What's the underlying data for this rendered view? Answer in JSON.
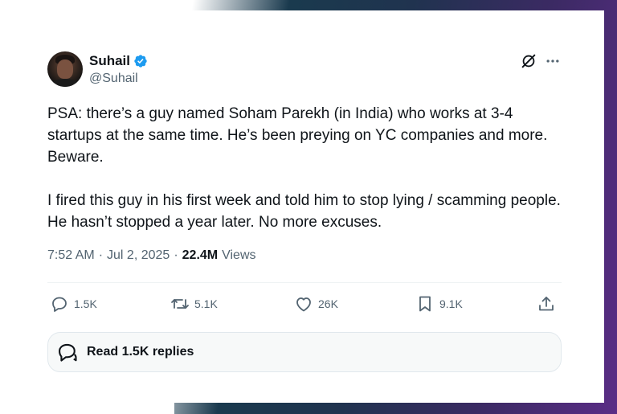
{
  "user": {
    "name": "Suhail",
    "handle": "@Suhail"
  },
  "tweet": {
    "text": "PSA: there’s a guy named Soham Parekh (in India) who works at 3-4 startups at the same time. He’s been preying on YC companies and more. Beware.\n\nI fired this guy in his first week and told him to stop lying / scamming people. He hasn’t stopped a year later. No more excuses.",
    "time": "7:52 AM",
    "separator1": "·",
    "date": "Jul 2, 2025",
    "separator2": "·",
    "views_count": "22.4M",
    "views_label": "Views"
  },
  "actions": {
    "reply_count": "1.5K",
    "retweet_count": "5.1K",
    "like_count": "26K",
    "bookmark_count": "9.1K"
  },
  "replies_button": {
    "label": "Read 1.5K replies"
  },
  "colors": {
    "verified_blue": "#1d9bf0",
    "text_primary": "#0f1419",
    "text_secondary": "#536471"
  },
  "icons": [
    "verified-badge-icon",
    "grok-icon",
    "more-icon",
    "reply-icon",
    "retweet-icon",
    "like-icon",
    "bookmark-icon",
    "share-icon",
    "replies-bubble-icon"
  ]
}
